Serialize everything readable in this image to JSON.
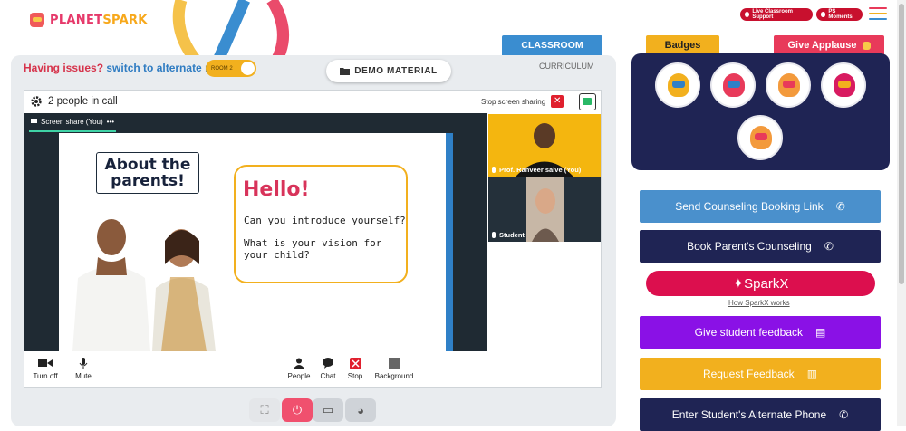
{
  "brand": {
    "logo_text_a": "PLANET",
    "logo_text_b": "SPARK"
  },
  "header": {
    "live_support_label": "Live Classroom Support",
    "ps_moments_label": "PS Moments",
    "colors": {
      "support": "#c8102e",
      "menu": [
        "#e83a5a",
        "#f2b01e",
        "#3a8dd0"
      ]
    }
  },
  "left": {
    "issues_text": "Having issues?",
    "switch_text": "switch to alternate room",
    "room_toggle": "ROOM 2",
    "demo_material": "DEMO MATERIAL",
    "tab_classroom": "CLASSROOM",
    "tab_curriculum": "CURRICULUM"
  },
  "call": {
    "people_count": "2 people in call",
    "stop_share": "Stop screen sharing",
    "screen_share_tab": "Screen share (You)",
    "more": "•••",
    "tiles": [
      {
        "name": "Prof. Ranveer salve (You)"
      },
      {
        "name": "Student"
      }
    ],
    "controls": {
      "turn_off": "Turn off",
      "mute": "Mute",
      "people": "People",
      "chat": "Chat",
      "stop": "Stop",
      "background": "Background"
    }
  },
  "slide": {
    "title": "About the parents!",
    "hello": "Hello!",
    "q1": "Can you introduce yourself?",
    "q2": "What is your vision for your child?"
  },
  "right": {
    "badges_tab": "Badges",
    "applause_tab": "Give Applause",
    "badges": [
      {
        "icon": "trophy-badge-icon"
      },
      {
        "icon": "superhero-badge-icon"
      },
      {
        "icon": "meditation-badge-icon"
      },
      {
        "icon": "speaker-badge-icon"
      },
      {
        "icon": "genius-badge-icon"
      }
    ],
    "buttons": {
      "send_booking": "Send Counseling Booking Link",
      "book_parent": "Book Parent's Counseling",
      "sparkx": "✦SparkX",
      "sparkx_link": "How SparkX works",
      "student_feedback": "Give student feedback",
      "request_feedback": "Request Feedback",
      "alternate_phone": "Enter Student's Alternate Phone"
    },
    "colors": {
      "send_booking": "#4a90cc",
      "book_parent": "#1f2454",
      "sparkx": "#dc0f4e",
      "student_feedback": "#8a11e6",
      "request_feedback": "#f2b01e",
      "alternate_phone": "#1f2454"
    }
  }
}
